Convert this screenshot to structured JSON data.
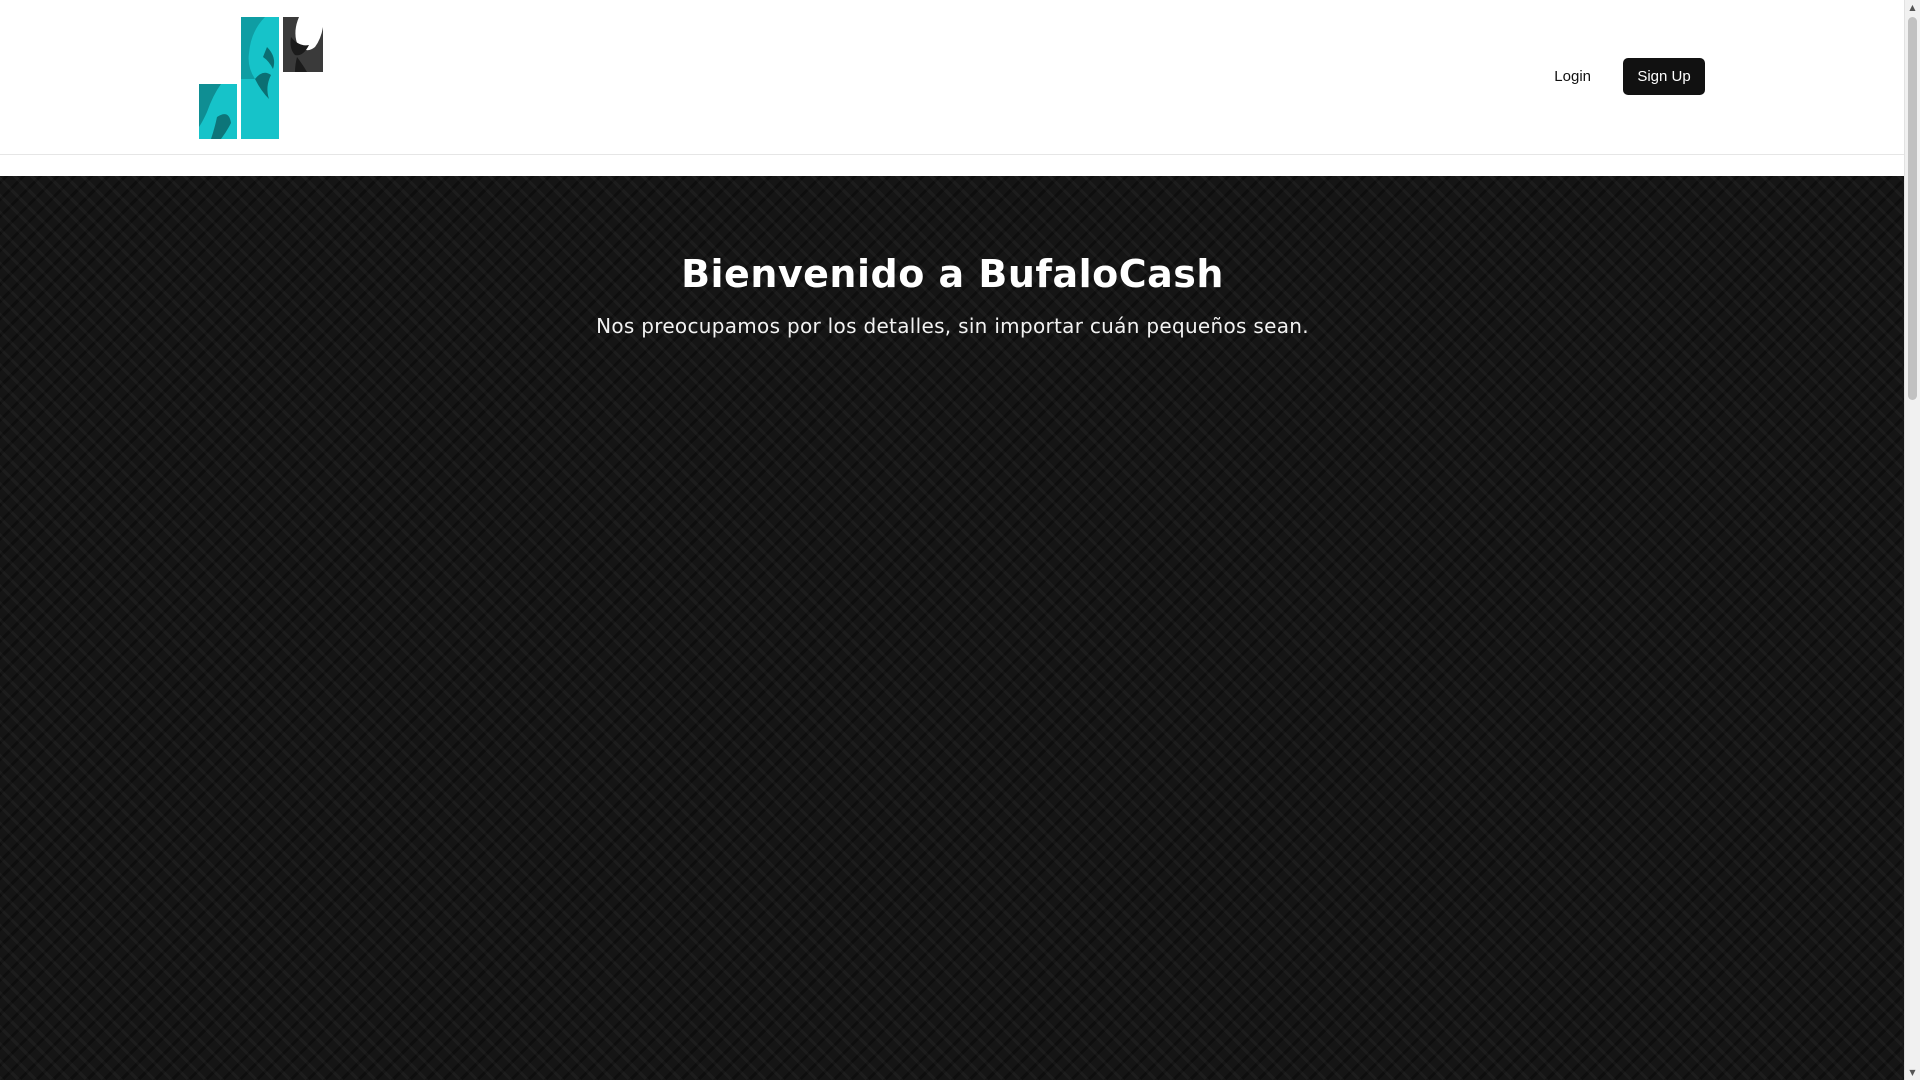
{
  "header": {
    "logo_alt": "BufaloCash logo",
    "login_label": "Login",
    "signup_label": "Sign Up"
  },
  "hero": {
    "title": "Bienvenido a BufaloCash",
    "subtitle": "Nos preocupamos por los detalles, sin importar cuán pequeños sean."
  },
  "colors": {
    "brand_teal": "#16c3c9",
    "brand_dark": "#3a3a3a",
    "hero_bg": "#151515",
    "button_bg": "#111111"
  },
  "icons": {
    "scroll_up": "▲",
    "scroll_down": "▼"
  }
}
